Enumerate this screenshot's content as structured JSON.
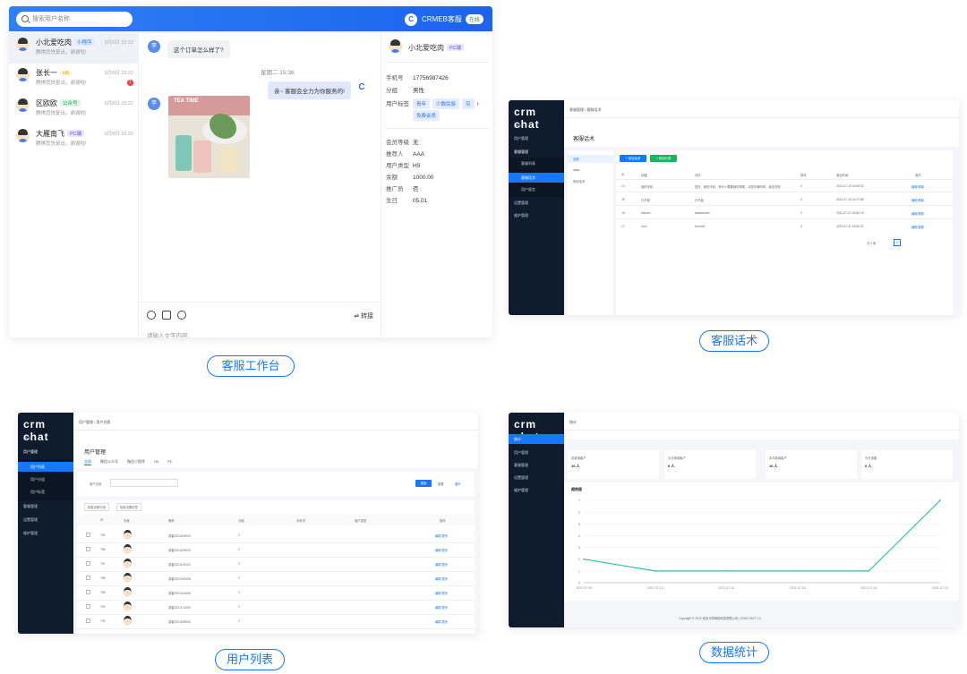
{
  "chat": {
    "search_placeholder": "搜索用户名称",
    "brand": "CRMEB客服",
    "status": "在线",
    "conversations": [
      {
        "name": "小北爱吃肉",
        "tag": "小程序",
        "msg": "腾祺您快复出，谢谢啦!",
        "time": "9月8日 15:22"
      },
      {
        "name": "张长一",
        "tag": "H5",
        "msg": "腾祺您快复出，谢谢啦!",
        "time": "9月8日 15:22",
        "unread": "1"
      },
      {
        "name": "区欧欧",
        "tag": "公众号",
        "msg": "腾祺您快复出，谢谢啦!",
        "time": "9月8日 15:22"
      },
      {
        "name": "大雁南飞",
        "tag": "PC端",
        "msg": "腾祺您快复出，谢谢啦!",
        "time": "9月8日 15:22"
      }
    ],
    "messages": {
      "q1": "这个订单怎么样了?",
      "divider": "星期二 15:36",
      "a1": "亲~ 客服会全力为你服务的!",
      "photo_title": "TEA TIME"
    },
    "transfer": "转接",
    "input_placeholder": "请输入文字内容",
    "profile": {
      "name": "小北爱吃肉",
      "tag": "PC端",
      "rows": [
        {
          "k": "手机号",
          "v": "17756987426"
        },
        {
          "k": "分组",
          "v": "男性"
        }
      ],
      "tags_label": "用户标签",
      "tags": [
        "青年",
        "少数民族",
        "穷",
        "免费会员"
      ],
      "rows2": [
        {
          "k": "会员等级",
          "v": "无"
        },
        {
          "k": "推荐人",
          "v": "AAA"
        },
        {
          "k": "用户类型",
          "v": "H5"
        },
        {
          "k": "余额",
          "v": "1000.00"
        },
        {
          "k": "推广员",
          "v": "否"
        },
        {
          "k": "生日",
          "v": "05.01"
        }
      ]
    }
  },
  "captions": {
    "c1": "客服工作台",
    "c2": "客服话术",
    "c3": "用户列表",
    "c4": "数据统计"
  },
  "admin": {
    "logo": "crm chat",
    "menu": [
      "统计",
      "用户管理",
      "客服管理",
      "设置管理",
      "维护管理"
    ],
    "w2": {
      "title": "客服话术",
      "crumb": "客服管理 / 客服话术",
      "sub": [
        "客服列表",
        "客服话术",
        "用户留言"
      ],
      "groups": [
        "全部",
        "aaaa",
        "常用话术"
      ],
      "btn_add": "+ 添加话术",
      "btn_cat": "+ 添加分类",
      "cols": [
        "ID",
        "标题",
        "详情",
        "排序",
        "添加时间",
        "操作"
      ],
      "rows": [
        [
          "14",
          "我的手机",
          "您好，我的手机，有什么需要我的帮助，请您尽管吩咐，我会尽快",
          "0",
          "2021-07-19 16:08:03",
          "编辑 删除"
        ],
        [
          "15",
          "行不起",
          "行不起",
          "0",
          "2021-07-19 14:27:58",
          "编辑 删除"
        ],
        [
          "16",
          "ddccsd",
          "aadaddded",
          "0",
          "2021-07-21 15:50:19",
          "编辑 删除"
        ],
        [
          "17",
          "vvvv",
          "fvvvvdd",
          "0",
          "2021-07-21 15:50:37",
          "编辑 删除"
        ]
      ],
      "pager": "共 4 条"
    },
    "w3": {
      "title": "用户管理",
      "crumb": "用户管理 / 用户列表",
      "sub": [
        "用户列表",
        "用户分组",
        "用户标签"
      ],
      "tabs": [
        "全部",
        "微信公众号",
        "微信小程序",
        "H5",
        "PC"
      ],
      "search_label": "用户名称",
      "btn_search": "搜索",
      "btn_reset": "重置",
      "btn_expand": "展开",
      "btn_group": "批量设置分组",
      "btn_tag": "批量设置标签",
      "cols": [
        "ID",
        "头像",
        "昵称",
        "分组",
        "手机号",
        "用户类型",
        "操作"
      ],
      "rows": [
        [
          "799",
          "游客2021109003",
          "0"
        ],
        [
          "798",
          "游客2021109004",
          "0"
        ],
        [
          "797",
          "游客2021109102",
          "0"
        ],
        [
          "796",
          "游客2021093195",
          "0"
        ],
        [
          "795",
          "游客2021041060",
          "0"
        ],
        [
          "794",
          "游客2021171090",
          "0"
        ],
        [
          "793",
          "游客2021159052",
          "0"
        ]
      ],
      "ops": "编辑  更多"
    },
    "w4": {
      "crumb": "统计",
      "cards": [
        {
          "label": "总新增客户",
          "value": "10 人"
        },
        {
          "label": "今日新增客户",
          "value": "0 人"
        },
        {
          "label": "本月新增客户",
          "value": "10 人"
        },
        {
          "label": "今日游客",
          "value": "0 人"
        }
      ],
      "chart_title": "趋势图",
      "footer": "Copyright © 2020 西安众邦网络科技有限公司 | CRM-CHAT 1.0"
    }
  },
  "chart_data": {
    "type": "line",
    "title": "趋势图",
    "x": [
      "2021-07-09",
      "2021-07-13",
      "2021-07-15",
      "2021-07-16",
      "2021-07-19",
      "2021-07-20"
    ],
    "series": [
      {
        "name": "",
        "values": [
          2,
          1,
          1,
          1,
          1,
          7
        ]
      }
    ],
    "ylim": [
      0,
      7
    ],
    "yticks": [
      0,
      1,
      2,
      3,
      4,
      5,
      6,
      7
    ],
    "line_color": "#34c1a4"
  }
}
